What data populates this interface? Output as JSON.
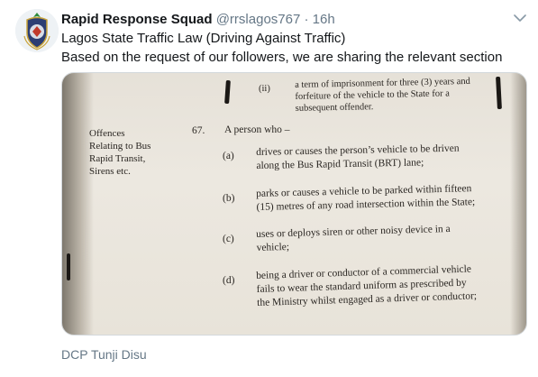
{
  "tweet": {
    "author_name": "Rapid Response Squad",
    "handle": "@rrslagos767",
    "separator": "·",
    "time": "16h",
    "line1": "Lagos State Traffic Law (Driving Against Traffic)",
    "line2": "Based on the request of our followers, we are sharing the relevant section"
  },
  "document": {
    "top_item_num": "(ii)",
    "top_item_lines": [
      "a term of imprisonment for three (3) years and",
      "forfeiture of the vehicle to the State for a",
      "subsequent offender."
    ],
    "margin_heading": [
      "Offences",
      "Relating to Bus",
      "Rapid Transit,",
      "Sirens etc."
    ],
    "section_number": "67.",
    "section_lead": "A person who –",
    "items": [
      {
        "label": "(a)",
        "lines": [
          "drives or causes the person’s vehicle to be driven",
          "along the Bus Rapid Transit (BRT) lane;"
        ]
      },
      {
        "label": "(b)",
        "lines": [
          "parks or causes a vehicle to be parked within fifteen",
          "(15) metres of any road intersection within the State;"
        ]
      },
      {
        "label": "(c)",
        "lines": [
          "uses or deploys siren or other noisy device in a",
          "vehicle;"
        ]
      },
      {
        "label": "(d)",
        "lines": [
          "being a driver or conductor of a commercial vehicle",
          "fails to wear the standard uniform as prescribed by",
          "the Ministry whilst engaged as a driver or conductor;"
        ]
      }
    ]
  },
  "media_author": "DCP Tunji Disu",
  "icons": {
    "avatar": "rrs-crest-icon",
    "caret": "chevron-down-icon"
  },
  "colors": {
    "name": "#14171a",
    "muted": "#657786",
    "border": "#d3d8dc"
  }
}
